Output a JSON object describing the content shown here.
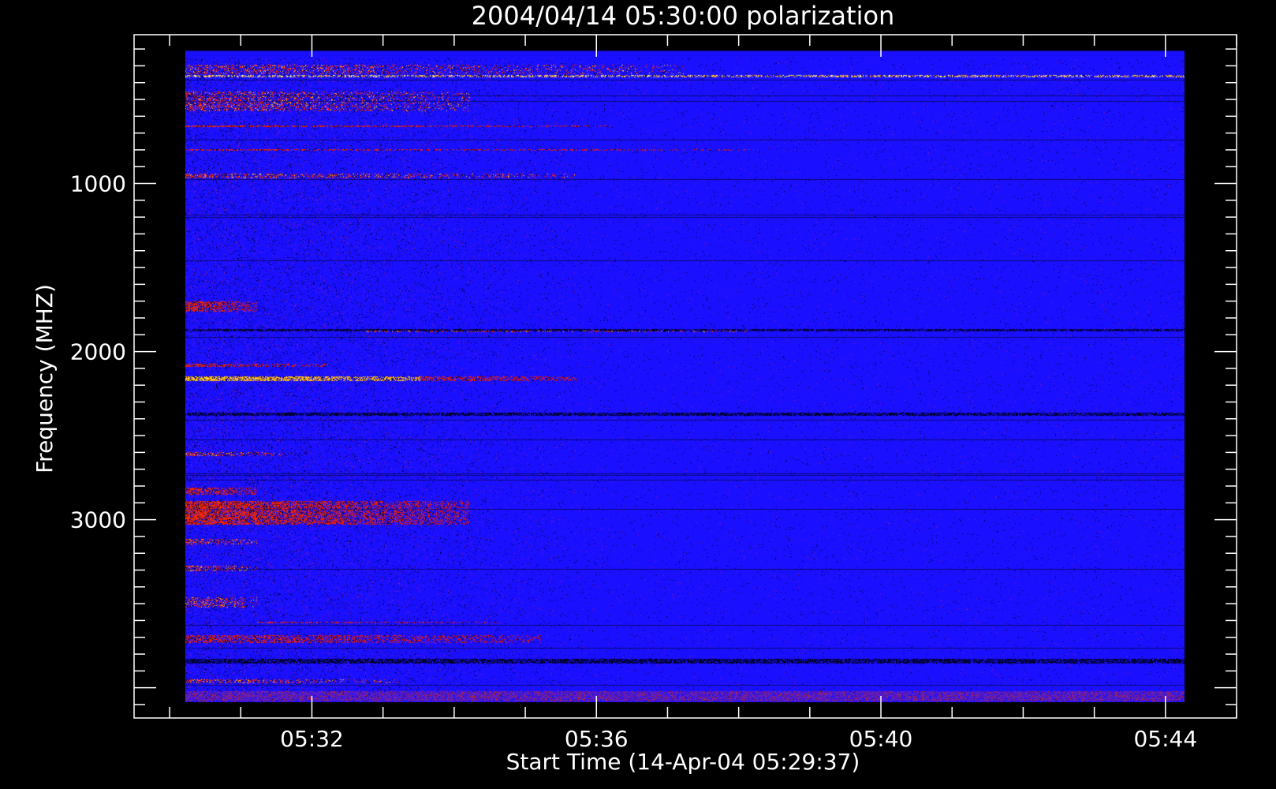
{
  "chart_data": {
    "type": "heatmap",
    "title": "2004/04/14 05:30:00 polarization",
    "xlabel": "Start Time (14-Apr-04 05:29:37)",
    "ylabel": "Frequency (MHZ)",
    "x_ticks": [
      "05:32",
      "05:36",
      "05:40",
      "05:44"
    ],
    "x_tick_values_min": [
      2,
      6,
      10,
      14
    ],
    "x_range_min": [
      -0.5,
      15.0
    ],
    "y_ticks": [
      1000,
      2000,
      3000
    ],
    "y_range": [
      115,
      4180
    ],
    "data_range": {
      "x_min": [
        0,
        15.0
      ],
      "y_mhz": [
        200,
        4080
      ]
    },
    "grid": false,
    "colors": {
      "background": "#000000",
      "axes": "#ffffff",
      "baseline": "#1a10ff",
      "dark": "#000040",
      "red": "#ff1a00",
      "orange": "#ff9a1a",
      "yellow": "#ffff80",
      "violet": "#6a1aa8"
    },
    "bands": [
      {
        "f": 200,
        "w": 80,
        "start": 0.0,
        "end": 15.0,
        "int": 0.0,
        "kind": "top"
      },
      {
        "f": 350,
        "w": 12,
        "start": 0.0,
        "end": 15.0,
        "int": 1.0,
        "kind": "spark"
      },
      {
        "f": 310,
        "w": 60,
        "start": 0.0,
        "end": 7.0,
        "int": 0.6,
        "kind": "speck"
      },
      {
        "f": 500,
        "w": 120,
        "start": 0.0,
        "end": 4.0,
        "int": 0.7,
        "kind": "speck"
      },
      {
        "f": 650,
        "w": 10,
        "start": 0.0,
        "end": 6.0,
        "int": 0.9,
        "kind": "solid"
      },
      {
        "f": 790,
        "w": 10,
        "start": 0.0,
        "end": 8.0,
        "int": 0.7,
        "kind": "solid"
      },
      {
        "f": 945,
        "w": 30,
        "start": 0.0,
        "end": 5.5,
        "int": 0.7,
        "kind": "speck"
      },
      {
        "f": 1720,
        "w": 60,
        "start": 0.0,
        "end": 1.0,
        "int": 0.8,
        "kind": "solid"
      },
      {
        "f": 1860,
        "w": 14,
        "start": 0.0,
        "end": 15.0,
        "int": 0.5,
        "kind": "dark"
      },
      {
        "f": 1870,
        "w": 10,
        "start": 2.5,
        "end": 8.0,
        "int": 0.7,
        "kind": "speck"
      },
      {
        "f": 2070,
        "w": 20,
        "start": 0.0,
        "end": 2.0,
        "int": 0.8,
        "kind": "solid"
      },
      {
        "f": 2150,
        "w": 28,
        "start": 0.0,
        "end": 5.5,
        "int": 1.0,
        "kind": "solid"
      },
      {
        "f": 2360,
        "w": 20,
        "start": 0.0,
        "end": 15.0,
        "int": 0.3,
        "kind": "dark"
      },
      {
        "f": 2600,
        "w": 24,
        "start": 0.0,
        "end": 1.5,
        "int": 0.9,
        "kind": "speck"
      },
      {
        "f": 2820,
        "w": 40,
        "start": 0.0,
        "end": 1.0,
        "int": 0.8,
        "kind": "solid"
      },
      {
        "f": 2950,
        "w": 140,
        "start": 0.0,
        "end": 4.0,
        "int": 0.9,
        "kind": "solid"
      },
      {
        "f": 3120,
        "w": 30,
        "start": 0.0,
        "end": 1.0,
        "int": 0.8,
        "kind": "speck"
      },
      {
        "f": 3280,
        "w": 30,
        "start": 0.0,
        "end": 1.0,
        "int": 0.9,
        "kind": "speck"
      },
      {
        "f": 3480,
        "w": 60,
        "start": 0.0,
        "end": 1.0,
        "int": 0.8,
        "kind": "speck"
      },
      {
        "f": 3600,
        "w": 10,
        "start": 1.0,
        "end": 4.5,
        "int": 0.7,
        "kind": "solid"
      },
      {
        "f": 3700,
        "w": 50,
        "start": 0.0,
        "end": 5.0,
        "int": 0.6,
        "kind": "solid"
      },
      {
        "f": 3830,
        "w": 30,
        "start": 0.0,
        "end": 15.0,
        "int": 0.3,
        "kind": "dark"
      },
      {
        "f": 3950,
        "w": 20,
        "start": 0.0,
        "end": 3.0,
        "int": 0.8,
        "kind": "speck"
      },
      {
        "f": 4040,
        "w": 60,
        "start": 0.0,
        "end": 15.0,
        "int": 0.5,
        "kind": "violet"
      }
    ]
  }
}
